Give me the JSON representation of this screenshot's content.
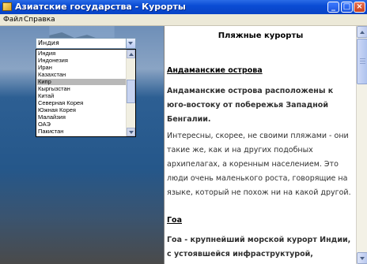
{
  "window": {
    "title": "Азиатские государства - Курорты",
    "buttons": {
      "minimize": "_",
      "maximize": "□",
      "close": "×"
    }
  },
  "menu": {
    "file": "Файл",
    "help": "Справка"
  },
  "country_select": {
    "value": "Индия",
    "options": [
      "Индия",
      "Индонезия",
      "Иран",
      "Казахстан",
      "Кипр",
      "Кыргызстан",
      "Китай",
      "Северная Корея",
      "Южная Корея",
      "Малайзия",
      "ОАЭ",
      "Пакистан"
    ],
    "selected_index": 4
  },
  "content": {
    "heading": "Пляжные курорты",
    "sections": [
      {
        "title": "Андаманские острова",
        "para1": "Андаманские острова расположены к юго-востоку от побережья Западной Бенгалии.",
        "para2": "Интересны, скорее, не своими пляжами - они такие же, как и на других подобных архипелагах, а коренным населением. Это люди очень маленького роста, говорящие на языке, который не похож ни на какой другой."
      },
      {
        "title": "Гоа",
        "para1": "Гоа - крупнейший морской курорт Индии, с устоявшейся инфраструктурой,"
      }
    ]
  },
  "colors": {
    "titlebar": "#0a4cd4",
    "list_selected": "#b8b8b8"
  }
}
